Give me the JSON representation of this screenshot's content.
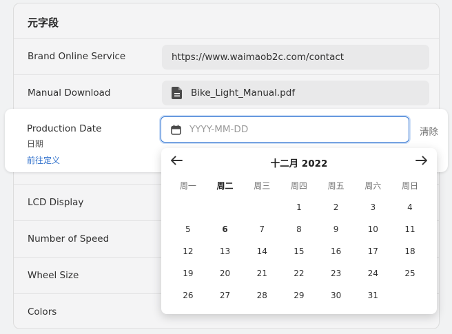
{
  "card": {
    "title": "元字段",
    "rows": [
      {
        "label": "Brand Online Service",
        "value": "https://www.waimaob2c.com/contact"
      },
      {
        "label": "Manual Download",
        "value": "Bike_Light_Manual.pdf",
        "icon": "file-icon"
      },
      {
        "label": "LCD Display"
      },
      {
        "label": "Number of Speed"
      },
      {
        "label": "Wheel Size"
      },
      {
        "label": "Colors"
      }
    ]
  },
  "production": {
    "label": "Production Date",
    "sub": "日期",
    "link": "前往定义",
    "placeholder": "YYYY-MM-DD",
    "clear": "清除",
    "icon": "calendar-icon"
  },
  "calendar": {
    "title": "十二月 2022",
    "weekdays": [
      "周一",
      "周二",
      "周三",
      "周四",
      "周五",
      "周六",
      "周日"
    ],
    "today_weekday_index": 1,
    "today": 6,
    "first_weekday_index": 3,
    "days_in_month": 31,
    "prev_icon": "arrow-left-icon",
    "next_icon": "arrow-right-icon"
  },
  "colors": {
    "accent": "#3b7bd4",
    "link": "#2c6ecb",
    "page_bg": "#f1f2f3"
  }
}
